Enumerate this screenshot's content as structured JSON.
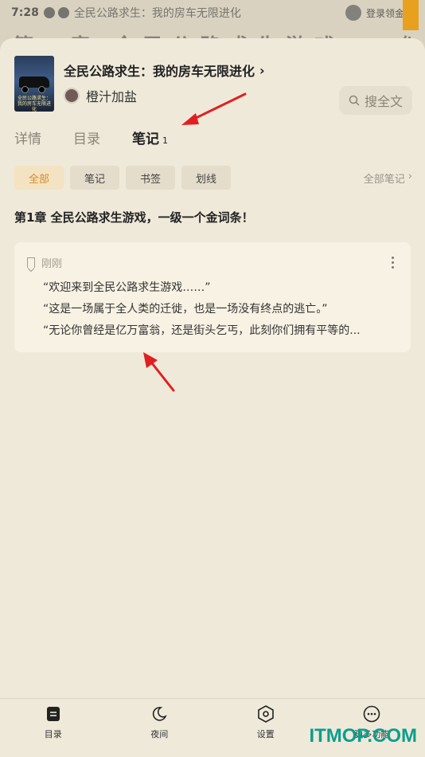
{
  "status_bar": {
    "time": "7:28",
    "background_title": "全民公路求生：我的房车无限进化",
    "right_text": "登录领金币"
  },
  "background_heading": "第一章 全民公路求生游戏，一级一个",
  "book": {
    "title": "全民公路求生：我的房车无限进化",
    "author": "橙汁加盐",
    "cover_text": "全民公路求生：我的房车无限进化"
  },
  "search": {
    "label": "搜全文",
    "icon": "search-icon"
  },
  "tabs": [
    {
      "label": "详情"
    },
    {
      "label": "目录"
    },
    {
      "label": "笔记",
      "count": "1"
    }
  ],
  "filters": [
    "全部",
    "笔记",
    "书签",
    "划线"
  ],
  "all_notes_link": "全部笔记",
  "chapter_title": "第1章 全民公路求生游戏，一级一个金词条！",
  "note": {
    "time": "刚刚",
    "lines": [
      "“欢迎来到全民公路求生游戏……”",
      "“这是一场属于全人类的迁徙，也是一场没有终点的逃亡。”",
      "“无论你曾经是亿万富翁，还是街头乞丐，此刻你们拥有平等的..."
    ]
  },
  "bottom_nav": [
    {
      "label": "目录",
      "icon": "catalog-icon"
    },
    {
      "label": "夜间",
      "icon": "moon-icon"
    },
    {
      "label": "设置",
      "icon": "settings-icon"
    },
    {
      "label": "更多功能",
      "icon": "more-icon"
    }
  ],
  "watermark": "ITMOP.COM",
  "colors": {
    "accent": "#d98a2a",
    "arrow": "#e02020",
    "sheet": "#efe9da",
    "card": "#f8f2e4"
  }
}
